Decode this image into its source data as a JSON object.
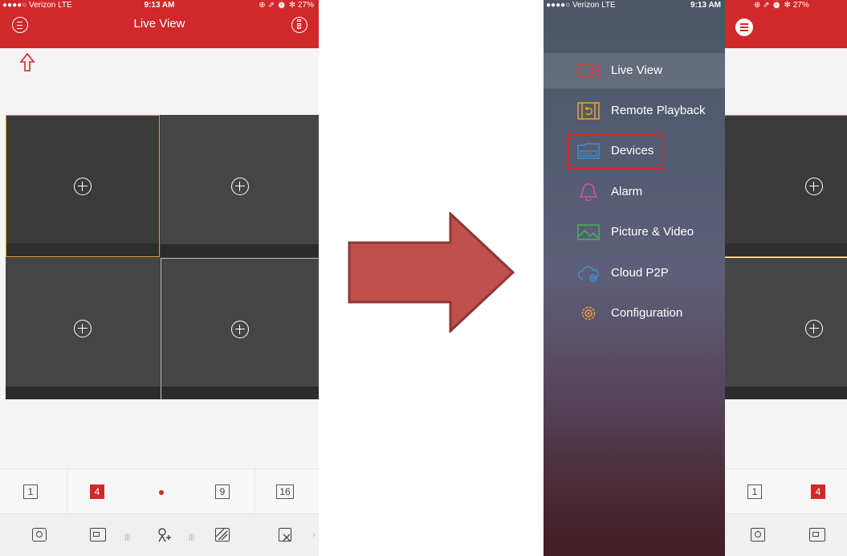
{
  "status_bar": {
    "carrier": "●●●●○ Verizon  LTE",
    "time": "9:13 AM",
    "right_icons": "⊕ ⇗ ⏰ ✻ 27%"
  },
  "left_screen": {
    "title": "Live View",
    "layout_options": [
      "1",
      "4",
      "9",
      "16"
    ],
    "active_layout": "4"
  },
  "right_screen": {
    "menu": [
      {
        "label": "Live View",
        "icon": "camera-icon",
        "color": "#e53935"
      },
      {
        "label": "Remote Playback",
        "icon": "film-playback-icon",
        "color": "#f0a030"
      },
      {
        "label": "Devices",
        "icon": "dvr-device-icon",
        "color": "#3d8fd8"
      },
      {
        "label": "Alarm",
        "icon": "bell-icon",
        "color": "#d84fb0"
      },
      {
        "label": "Picture & Video",
        "icon": "picture-icon",
        "color": "#3fb950"
      },
      {
        "label": "Cloud P2P",
        "icon": "cloud-icon",
        "color": "#3d8fd8"
      },
      {
        "label": "Configuration",
        "icon": "gear-icon",
        "color": "#f0a030"
      }
    ],
    "highlighted_item": "Devices",
    "behind_layout_options": [
      "1",
      "4"
    ]
  },
  "colors": {
    "brand_red": "#d0282b",
    "selected_pane_border": "#e0a020",
    "arrow_fill": "#c0504d",
    "arrow_stroke": "#8c3836"
  }
}
